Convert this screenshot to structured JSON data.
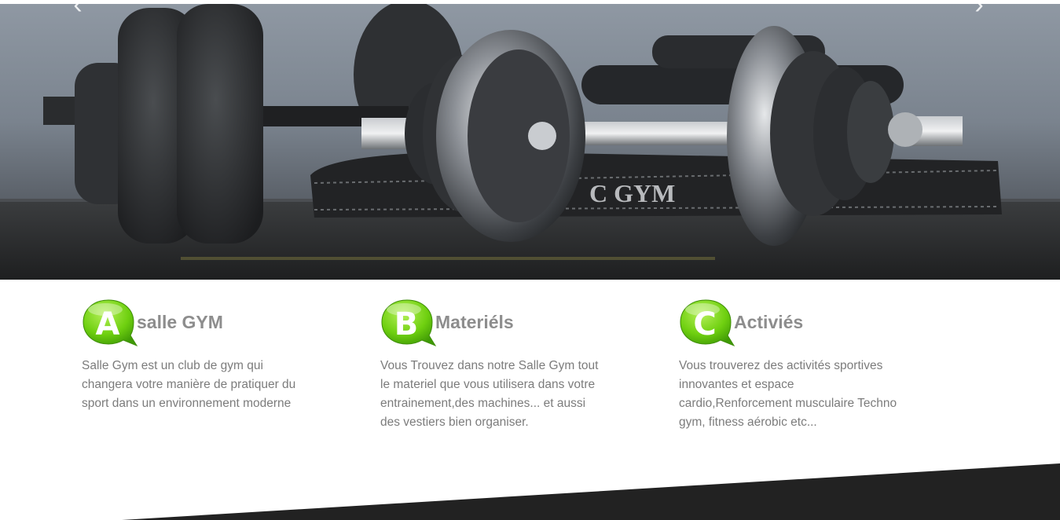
{
  "hero": {
    "prev_arrow": "‹",
    "next_arrow": "›",
    "belt_text": "C GYM"
  },
  "features": [
    {
      "letter": "A",
      "title": "salle GYM",
      "text": "Salle Gym est un club de gym qui changera votre manière de pratiquer du sport dans un environnement moderne"
    },
    {
      "letter": "B",
      "title": "Materiéls",
      "text": "Vous Trouvez dans notre Salle Gym tout le materiel que vous utilisera dans votre entrainement,des machines... et aussi des vestiers bien organiser."
    },
    {
      "letter": "C",
      "title": "Activiés",
      "text": "Vous trouverez des activités sportives innovantes et espace cardio,Renforcement musculaire Techno gym, fitness aérobic etc..."
    }
  ],
  "colors": {
    "badge_green": "#5fc10a",
    "badge_light": "#a8e84a",
    "title_gray": "#8d8d8d",
    "text_gray": "#7c7c7c",
    "footer_dark": "#222222"
  }
}
